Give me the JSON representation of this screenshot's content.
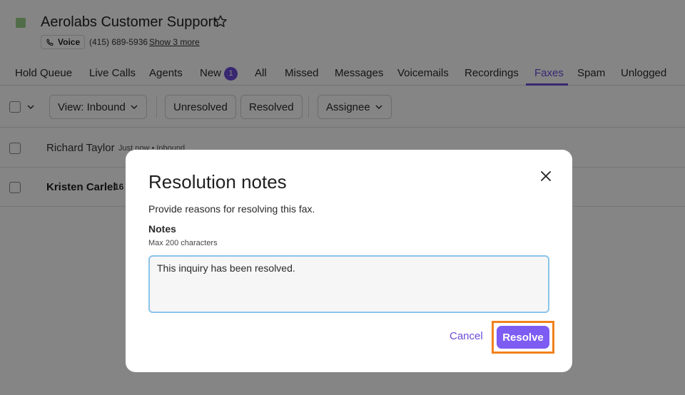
{
  "app": {
    "title": "Aerolabs Customer Support",
    "voice_label": "Voice",
    "phone_number": "(415) 689-5936",
    "show_more": "Show 3 more",
    "brand_color": "#9bcf8a"
  },
  "tabs": [
    {
      "label": "Hold Queue"
    },
    {
      "label": "Live Calls"
    },
    {
      "label": "Agents"
    },
    {
      "label": "New",
      "badge": "1"
    },
    {
      "label": "All"
    },
    {
      "label": "Missed"
    },
    {
      "label": "Messages"
    },
    {
      "label": "Voicemails"
    },
    {
      "label": "Recordings"
    },
    {
      "label": "Faxes",
      "active": true
    },
    {
      "label": "Spam"
    },
    {
      "label": "Unlogged"
    }
  ],
  "toolbar": {
    "view_label": "View: Inbound",
    "unresolved_label": "Unresolved",
    "resolved_label": "Resolved",
    "assignee_label": "Assignee"
  },
  "rows": [
    {
      "name": "Richard Taylor",
      "meta": "Just now • Inbound"
    },
    {
      "name": "Kristen Carlel",
      "meta": "16"
    }
  ],
  "modal": {
    "title": "Resolution notes",
    "description": "Provide reasons for resolving this fax.",
    "notes_label": "Notes",
    "notes_hint": "Max 200 characters",
    "notes_value": "This inquiry has been resolved.",
    "cancel_label": "Cancel",
    "resolve_label": "Resolve"
  },
  "colors": {
    "accent": "#6c4bd8",
    "resolve_button": "#7c5cf2",
    "highlight": "#f0821c"
  }
}
